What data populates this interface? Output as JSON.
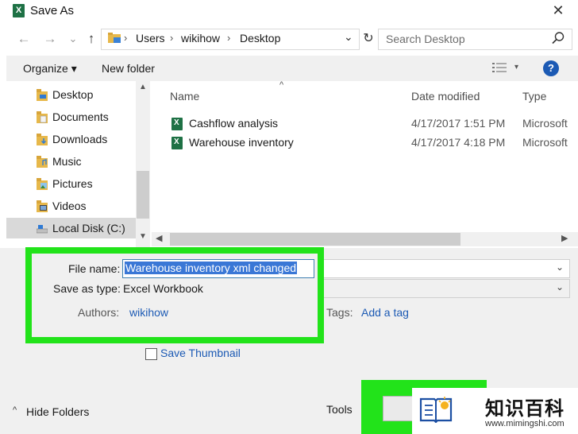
{
  "window": {
    "title": "Save As",
    "app_icon": "excel-icon",
    "close_glyph": "✕"
  },
  "nav": {
    "back_glyph": "←",
    "forward_glyph": "→",
    "recent_glyph": "⌄",
    "up_glyph": "↑",
    "breadcrumb": [
      "Users",
      "wikihow",
      "Desktop"
    ],
    "crumb_sep": "›",
    "dropdown_glyph": "⌄",
    "refresh_glyph": "↻",
    "search_placeholder": "Search Desktop"
  },
  "toolbar": {
    "organize": "Organize ▾",
    "new_folder": "New folder",
    "view_caret": "▾",
    "help": "?"
  },
  "sidebar": {
    "items": [
      {
        "label": "Desktop",
        "icon": "desktop-folder-icon"
      },
      {
        "label": "Documents",
        "icon": "documents-folder-icon"
      },
      {
        "label": "Downloads",
        "icon": "downloads-folder-icon"
      },
      {
        "label": "Music",
        "icon": "music-folder-icon"
      },
      {
        "label": "Pictures",
        "icon": "pictures-folder-icon"
      },
      {
        "label": "Videos",
        "icon": "videos-folder-icon"
      },
      {
        "label": "Local Disk (C:)",
        "icon": "local-disk-icon",
        "selected": true
      }
    ],
    "scroll_up": "▲",
    "scroll_down": "▼"
  },
  "filelist": {
    "columns": {
      "name": "Name",
      "date": "Date modified",
      "type": "Type"
    },
    "sort_caret": "^",
    "files": [
      {
        "name": "Cashflow analysis",
        "date": "4/17/2017 1:51 PM",
        "type": "Microsoft"
      },
      {
        "name": "Warehouse inventory",
        "date": "4/17/2017 4:18 PM",
        "type": "Microsoft"
      }
    ],
    "scroll_left": "◀",
    "scroll_right": "▶"
  },
  "form": {
    "file_name_label": "File name:",
    "file_name_value": "Warehouse inventory xml changed",
    "save_type_label": "Save as type:",
    "save_type_value": "Excel Workbook",
    "authors_label": "Authors:",
    "authors_value": "wikihow",
    "tags_label": "Tags:",
    "tags_value": "Add a tag",
    "save_thumbnail": "Save Thumbnail",
    "combo_arrow": "⌄"
  },
  "footer": {
    "hide_folders": "Hide Folders",
    "hide_caret": "^",
    "tools": "Tools"
  },
  "watermark": {
    "title": "知识百科",
    "url": "www.mimingshi.com"
  },
  "colors": {
    "highlight": "#22e31a",
    "selection": "#3a77d6",
    "link": "#1c5ab4",
    "excel": "#1e7145"
  }
}
